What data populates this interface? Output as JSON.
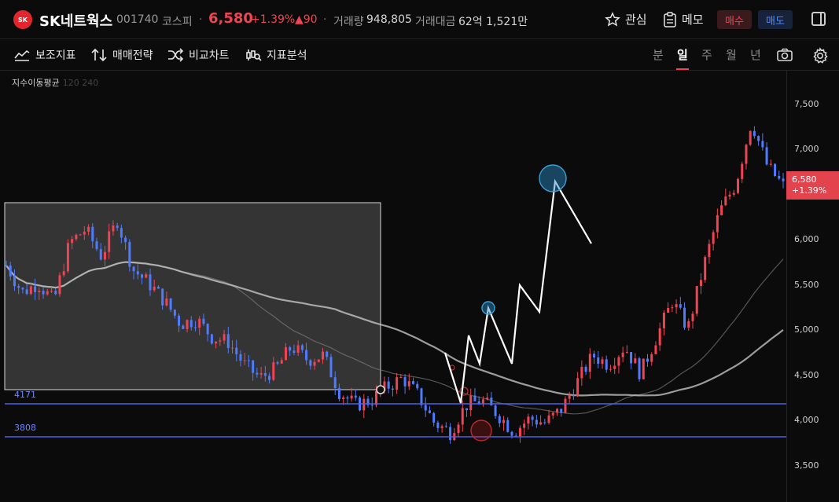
{
  "header": {
    "logo_text": "SK",
    "stock_name": "SK네트웍스",
    "stock_code": "001740",
    "market": "코스피",
    "price": "6,580",
    "change_pct": "+1.39%",
    "change_abs": "▲90",
    "volume_label": "거래량",
    "volume_value": "948,805",
    "amount_label": "거래대금",
    "amount_value": "62억 1,521만",
    "watch_label": "관심",
    "memo_label": "메모",
    "buy_label": "매수",
    "sell_label": "매도"
  },
  "toolbar": {
    "indicators_label": "보조지표",
    "strategy_label": "매매전략",
    "compare_label": "비교차트",
    "analysis_label": "지표분석",
    "periods": [
      "분",
      "일",
      "주",
      "월",
      "년"
    ],
    "active_period": "일"
  },
  "chart": {
    "ma_legend_name": "지수이동평균",
    "ma_legend_params": "120 240",
    "price_tag_price": "6,580",
    "price_tag_pct": "+1.39%",
    "level_upper": "4171",
    "level_lower": "3808",
    "colors": {
      "up": "#f04452",
      "down": "#4f7bff",
      "level": "#4e63e6",
      "annotation": "#ffffff"
    }
  },
  "chart_data": {
    "type": "candlestick",
    "y_ticks": [
      "7,500",
      "7,000",
      "6,500",
      "6,000",
      "5,500",
      "5,000",
      "4,500",
      "4,000",
      "3,500"
    ],
    "ylim": [
      3350,
      7700
    ],
    "current_price": 6580,
    "horizontal_levels": [
      4171,
      3808
    ],
    "moving_averages": [
      120,
      240
    ],
    "trend_points": [
      5700,
      5400,
      5500,
      5300,
      5950,
      6100,
      5800,
      6200,
      5650,
      5500,
      5300,
      5050,
      5100,
      4900,
      4850,
      4600,
      4450,
      4550,
      4800,
      4650,
      4700,
      4300,
      4150,
      4200,
      4350,
      4450,
      4250,
      3950,
      3850,
      4150,
      4200,
      4050,
      3850,
      4000,
      3950,
      4100,
      4400,
      4700,
      4600,
      4800,
      4500,
      4900,
      5300,
      5000,
      5700,
      6300,
      6600,
      7300,
      6800,
      6580
    ]
  }
}
